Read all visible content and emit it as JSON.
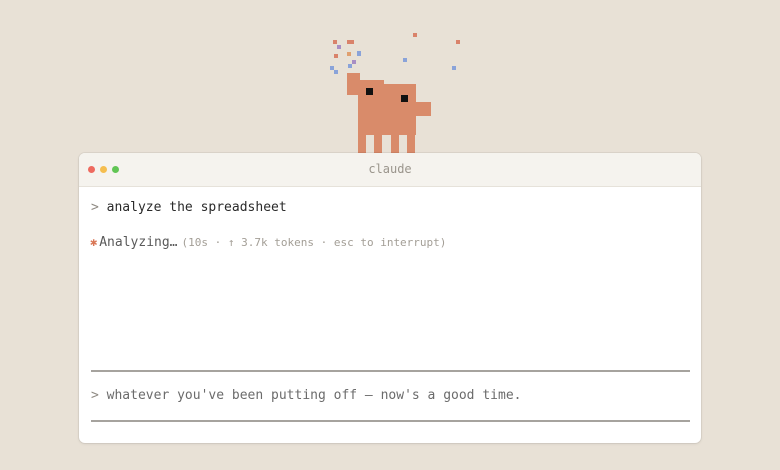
{
  "window": {
    "title": "claude"
  },
  "session": {
    "prompt_symbol": ">",
    "command": "analyze the spreadsheet",
    "status_icon": "asterisk-spinner-icon",
    "status_label": "Analyzing…",
    "status_detail": "(10s · ↑ 3.7k tokens · esc to interrupt)"
  },
  "input": {
    "prompt_symbol": ">",
    "placeholder": "whatever you've been putting off — now's a good time."
  },
  "colors": {
    "background": "#e8e1d6",
    "mascot": "#d98b6a",
    "accent": "#d97757",
    "confetti_red": "#d9826a",
    "confetti_blue": "#8aa3d9",
    "confetti_purple": "#a88ec4",
    "confetti_orange": "#e0a070"
  }
}
